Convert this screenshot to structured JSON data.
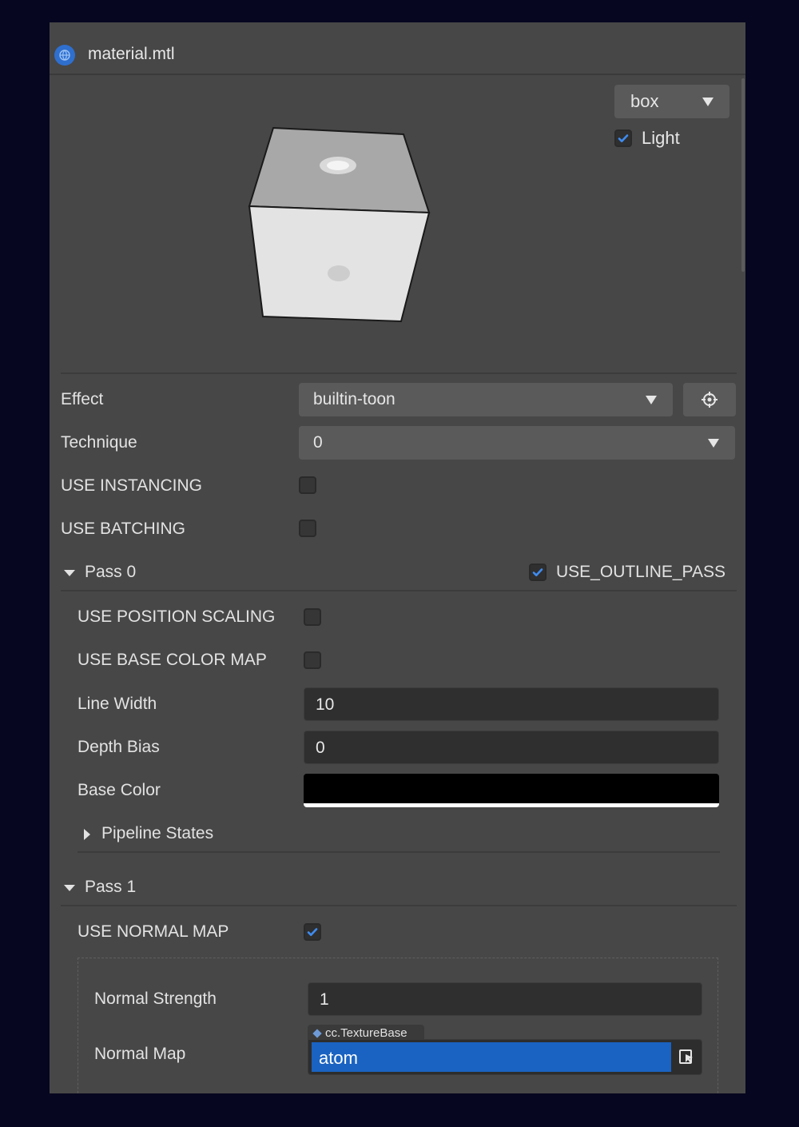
{
  "window": {
    "title": "material.mtl",
    "icon": "material-globe-icon"
  },
  "preview": {
    "mesh_select": {
      "value": "box"
    },
    "light": {
      "label": "Light",
      "checked": true
    }
  },
  "effect": {
    "label": "Effect",
    "value": "builtin-toon",
    "locate_icon": "crosshair-icon"
  },
  "technique": {
    "label": "Technique",
    "value": "0"
  },
  "use_instancing": {
    "label": "USE INSTANCING",
    "checked": false
  },
  "use_batching": {
    "label": "USE BATCHING",
    "checked": false
  },
  "pass0": {
    "label": "Pass 0",
    "expanded": true,
    "outline_pass": {
      "label": "USE_OUTLINE_PASS",
      "checked": true
    },
    "use_position_scaling": {
      "label": "USE POSITION SCALING",
      "checked": false
    },
    "use_base_color_map": {
      "label": "USE BASE COLOR MAP",
      "checked": false
    },
    "line_width": {
      "label": "Line Width",
      "value": "10"
    },
    "depth_bias": {
      "label": "Depth Bias",
      "value": "0"
    },
    "base_color": {
      "label": "Base Color",
      "color": "#000000"
    },
    "pipeline_states": {
      "label": "Pipeline States",
      "expanded": false
    }
  },
  "pass1": {
    "label": "Pass 1",
    "expanded": true,
    "use_normal_map": {
      "label": "USE NORMAL MAP",
      "checked": true
    },
    "normal_strength": {
      "label": "Normal Strength",
      "value": "1"
    },
    "normal_map": {
      "label": "Normal Map",
      "type_tag": "cc.TextureBase",
      "value": "atom"
    }
  },
  "colors": {
    "accent": "#1a63c2",
    "panel": "#474747",
    "background": "#060620"
  }
}
